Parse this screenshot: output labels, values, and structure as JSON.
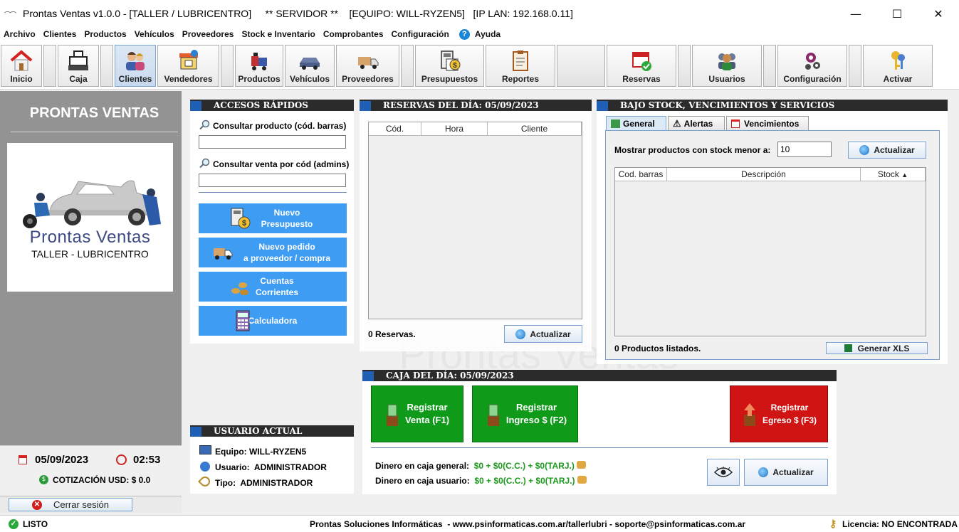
{
  "window": {
    "title": "Prontas Ventas v1.0.0 - [TALLER / LUBRICENTRO]     ** SERVIDOR **    [EQUIPO: WILL-RYZEN5]   [IP LAN: 192.168.0.11]",
    "minimize": "—",
    "maximize": "☐",
    "close": "✕"
  },
  "menu": {
    "items": [
      "Archivo",
      "Clientes",
      "Productos",
      "Vehículos",
      "Proveedores",
      "Stock e Inventario",
      "Comprobantes",
      "Configuración"
    ],
    "help": "Ayuda"
  },
  "toolbar": {
    "inicio": "Inicio",
    "caja": "Caja",
    "clientes": "Clientes",
    "vendedores": "Vendedores",
    "productos": "Productos",
    "vehiculos": "Vehículos",
    "proveedores": "Proveedores",
    "presupuestos": "Presupuestos",
    "reportes": "Reportes",
    "reservas": "Reservas",
    "usuarios": "Usuarios",
    "configuracion": "Configuración",
    "activar": "Activar"
  },
  "left": {
    "brand": "PRONTAS VENTAS",
    "logo_name": "Prontas Ventas",
    "logo_sub": "TALLER - LUBRICENTRO",
    "date": "05/09/2023",
    "time": "02:53",
    "cotizacion": "COTIZACIÓN USD: $ 0.0",
    "logout": "Cerrar sesión"
  },
  "accesos": {
    "header": "ACCESOS RÁPIDOS",
    "consultar_producto": "Consultar producto (cód. barras)",
    "consultar_producto_value": "",
    "consultar_venta": "Consultar venta por cód (admins)",
    "consultar_venta_value": "",
    "btn_presupuesto_1": "Nuevo",
    "btn_presupuesto_2": "Presupuesto",
    "btn_pedido_1": "Nuevo pedido",
    "btn_pedido_2": "a proveedor / compra",
    "btn_cuentas_1": "Cuentas",
    "btn_cuentas_2": "Corrientes",
    "btn_calc": "Calculadora"
  },
  "usuario": {
    "header": "USUARIO ACTUAL",
    "equipo_label": "Equipo:",
    "equipo": "WILL-RYZEN5",
    "usuario_label": "Usuario:",
    "usuario": "ADMINISTRADOR",
    "tipo_label": "Tipo:",
    "tipo": "ADMINISTRADOR"
  },
  "reservas": {
    "header": "RESERVAS DEL DÍA: 05/09/2023",
    "columns": [
      "Cód.",
      "Hora",
      "Cliente"
    ],
    "count": "0 Reservas.",
    "refresh": "Actualizar"
  },
  "stock": {
    "header": "BAJO STOCK, VENCIMIENTOS Y SERVICIOS",
    "tabs": [
      "General",
      "Alertas",
      "Vencimientos"
    ],
    "filter_label": "Mostrar productos con stock menor a:",
    "filter_value": "10",
    "refresh": "Actualizar",
    "columns": [
      "Cod. barras",
      "Descripción",
      "Stock"
    ],
    "sort_indicator": "▲",
    "count": "0 Productos listados.",
    "xls": "Generar XLS"
  },
  "caja": {
    "header": "CAJA DEL DÍA: 05/09/2023",
    "venta_1": "Registrar",
    "venta_2": "Venta (F1)",
    "ingreso_1": "Registrar",
    "ingreso_2": "Ingreso $ (F2)",
    "egreso_1": "Registrar",
    "egreso_2": "Egreso $ (F3)",
    "general_label": "Dinero en caja general:",
    "general_value": "$0 + $0(C.C.) + $0(TARJ.)",
    "usuario_label": "Dinero en caja usuario:",
    "usuario_value": "$0 + $0(C.C.) + $0(TARJ.)",
    "refresh": "Actualizar"
  },
  "watermark": "Prontas Ventas",
  "status": {
    "state": "LISTO",
    "footer": "Prontas Soluciones Informáticas  - www.psinformaticas.com.ar/tallerlubri - soporte@psinformaticas.com.ar",
    "license": "Licencia: NO ENCONTRADA"
  },
  "colors": {
    "accent_blue": "#3e9cf3",
    "header_dark": "#2b2b2b",
    "green_btn": "#0f9a19",
    "red_btn": "#d01414"
  }
}
